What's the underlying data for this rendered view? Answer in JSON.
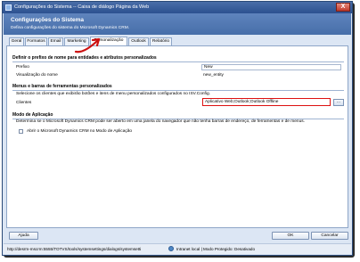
{
  "window": {
    "title": "Configurações do Sistema -- Caixa de diálogo Página da Web",
    "close_glyph": "X"
  },
  "header": {
    "title": "Configurações do Sistema",
    "subtitle": "Defina configurações do sistema do Microsoft Dynamics CRM."
  },
  "tabs": [
    {
      "label": "Geral",
      "active": false
    },
    {
      "label": "Formatos",
      "active": false
    },
    {
      "label": "Email",
      "active": false
    },
    {
      "label": "Marketing",
      "active": false
    },
    {
      "label": "Personalização",
      "active": true
    },
    {
      "label": "Outlook",
      "active": false
    },
    {
      "label": "Relatório",
      "active": false
    }
  ],
  "prefix_section": {
    "title": "Definir o prefixo de nome para entidades e atributos personalizados",
    "prefix_label": "Prefixo",
    "prefix_value": "New",
    "preview_label": "Visualização do nome",
    "preview_value": "new_entity"
  },
  "menus_section": {
    "title": "Menus e barras de ferramentas personalizados",
    "description": "Selecione os clientes que exibirão botões e itens de menu personalizados configurados no ISV.Config.",
    "clients_label": "Clientes",
    "clients_value": "Aplicativo Web;Outlook;Outlook Offline",
    "lookup_glyph": "..."
  },
  "app_mode_section": {
    "title": "Modo de Aplicação",
    "description": "Determina se o Microsoft Dynamics CRM pode ser aberto em uma janela do navegador que não tenha barras de endereço, de ferramentas e de menus.",
    "checkbox_label": "Abrir o Microsoft Dynamics CRM no Modo de Aplicação",
    "checked": false
  },
  "footer": {
    "help_label": "Ajuda",
    "ok_label": "OK",
    "cancel_label": "Cancelar"
  },
  "statusbar": {
    "url": "http://desrm-mscrm:5555/TOTVS/tools/systemsettings/dialogs/systemsetti",
    "zone": "Intranet local | Modo Protegido: Desativado"
  },
  "colors": {
    "highlight": "#dd1111",
    "header_blue": "#466ea9"
  }
}
